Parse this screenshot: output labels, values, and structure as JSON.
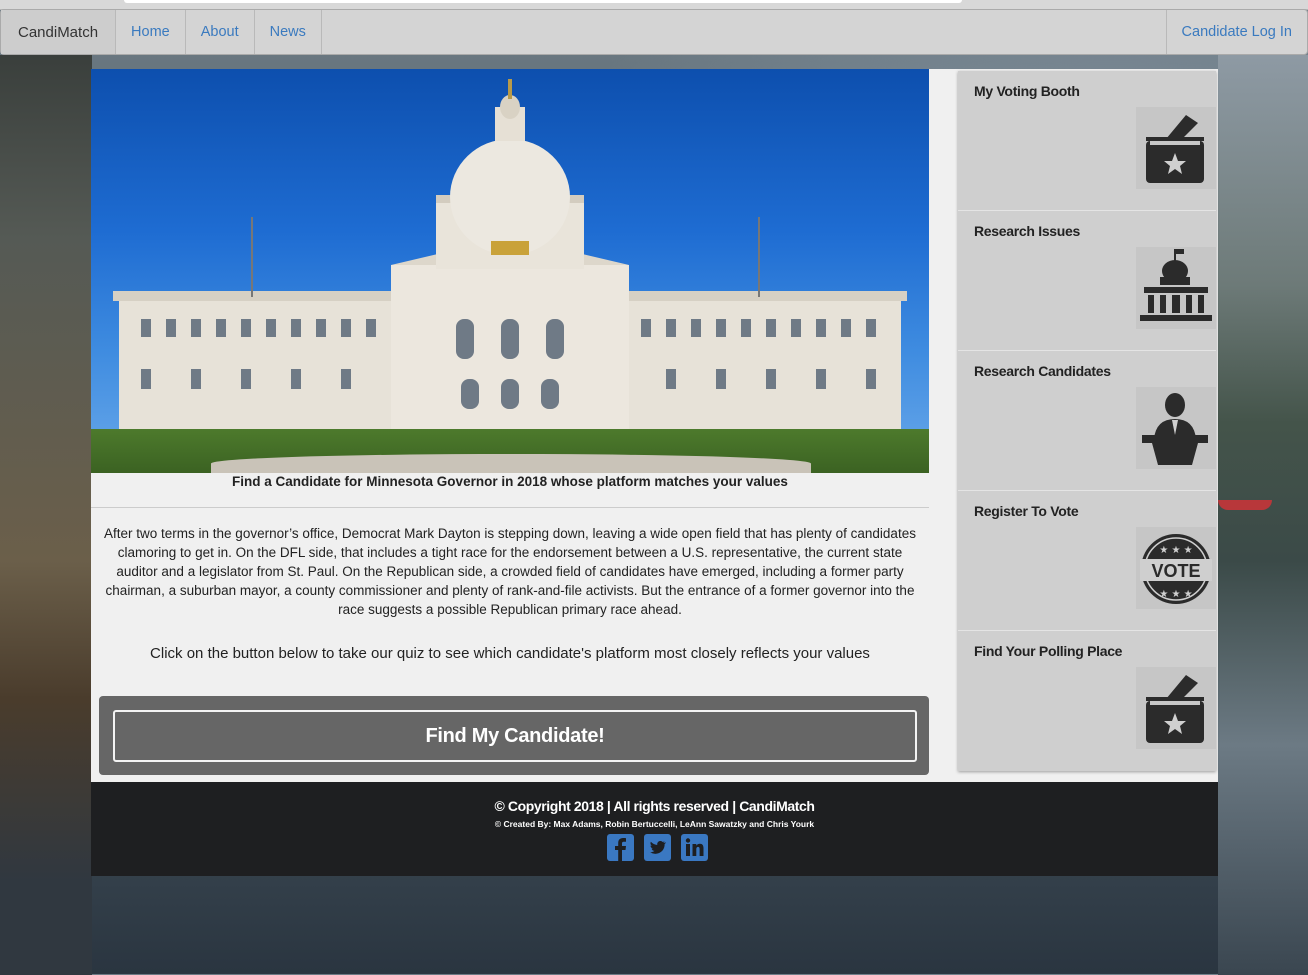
{
  "navbar": {
    "brand": "CandiMatch",
    "links": [
      "Home",
      "About",
      "News"
    ],
    "login": "Candidate Log In"
  },
  "main": {
    "caption": "Find a Candidate for Minnesota Governor in 2018 whose platform matches your values",
    "paragraph": "After two terms in the governor’s office, Democrat Mark Dayton is stepping down, leaving a wide open field that has plenty of candidates clamoring to get in. On the DFL side, that includes a tight race for the endorsement between a U.S. representative, the current state auditor and a legislator from St. Paul. On the Republican side, a crowded field of candidates have emerged, including a former party chairman, a suburban mayor, a county commissioner and plenty of rank-and-file activists. But the entrance of a former governor into the race suggests a possible Republican primary race ahead.",
    "cta": "Click on the button below to take our quiz to see which candidate's platform most closely reflects your values",
    "button": "Find My Candidate!"
  },
  "sidebar": {
    "items": [
      {
        "label": "My Voting Booth",
        "icon": "ballot-box-icon"
      },
      {
        "label": "Research Issues",
        "icon": "capitol-icon"
      },
      {
        "label": "Research Candidates",
        "icon": "speaker-podium-icon"
      },
      {
        "label": "Register To Vote",
        "icon": "vote-badge-icon"
      },
      {
        "label": "Find Your Polling Place",
        "icon": "ballot-box-icon"
      }
    ]
  },
  "footer": {
    "copyright": "© Copyright 2018 | All rights reserved | CandiMatch",
    "credits": "© Created By: Max Adams, Robin Bertuccelli, LeAnn Sawatzky and Chris Yourk",
    "social": [
      "facebook-icon",
      "twitter-icon",
      "linkedin-icon"
    ],
    "social_color": "#3a78c2"
  },
  "colors": {
    "link": "#3a7abf",
    "button_bg": "#666666",
    "footer_bg": "#1e1f21",
    "sidebar_bg": "#cfcfcf"
  }
}
